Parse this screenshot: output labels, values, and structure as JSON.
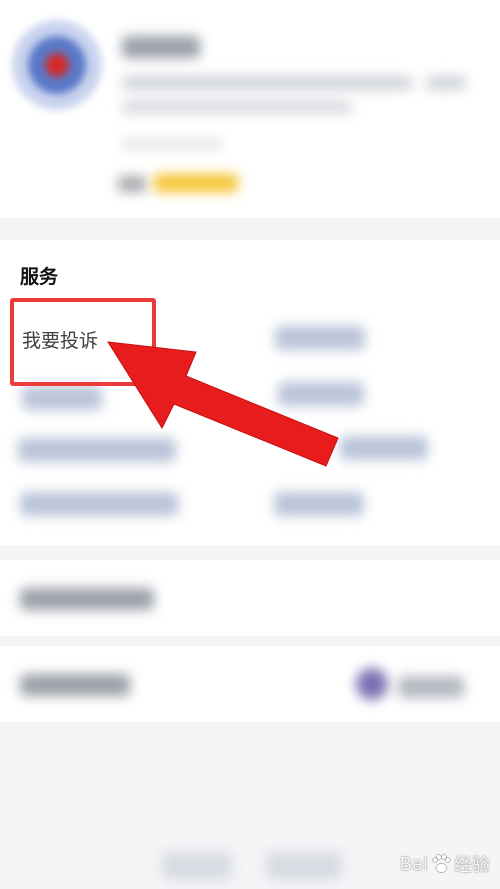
{
  "services": {
    "title": "服务",
    "highlighted_item": "我要投诉"
  },
  "annotation": {
    "box_color": "#ec3b3b",
    "arrow_color": "#e81c1c"
  },
  "watermark": {
    "brand_left": "Bai",
    "brand_right": "经验"
  },
  "colors": {
    "accent_yellow": "#f5c531",
    "page_bg": "#f4f5f7"
  }
}
